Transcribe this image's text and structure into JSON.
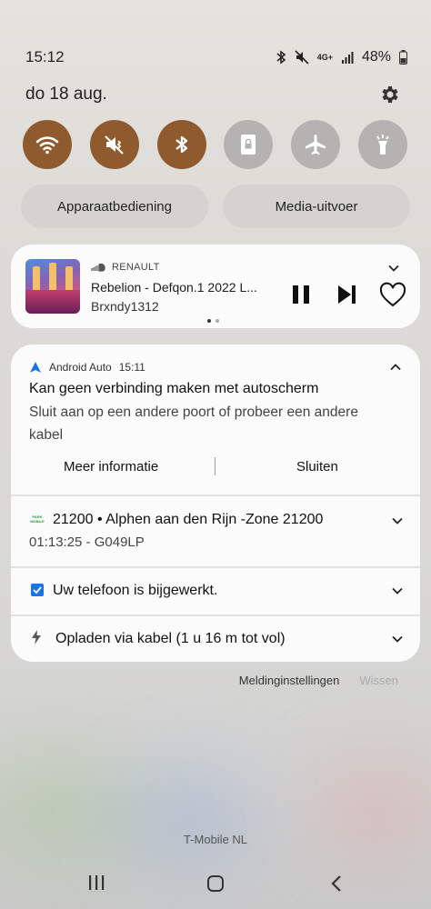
{
  "status_bar": {
    "time": "15:12",
    "battery": "48%",
    "network": "4G+"
  },
  "header": {
    "date": "do 18 aug."
  },
  "quick_toggles": [
    {
      "name": "wifi",
      "icon": "wifi-icon",
      "state": "on"
    },
    {
      "name": "mute",
      "icon": "mute-icon",
      "state": "on"
    },
    {
      "name": "bluetooth",
      "icon": "bluetooth-icon",
      "state": "on"
    },
    {
      "name": "auto-rotate",
      "icon": "portrait-lock-icon",
      "state": "off"
    },
    {
      "name": "airplane",
      "icon": "airplane-icon",
      "state": "off"
    },
    {
      "name": "flashlight",
      "icon": "flashlight-icon",
      "state": "off"
    }
  ],
  "pills": {
    "device_control": "Apparaatbediening",
    "media_output": "Media-uitvoer"
  },
  "media": {
    "source": "RENAULT",
    "title": "Rebelion  - Defqon.1 2022 L...",
    "artist": "Brxndy1312"
  },
  "notifications": {
    "android_auto": {
      "app": "Android Auto",
      "time": "15:11",
      "title": "Kan geen verbinding maken met autoscherm",
      "body": "Sluit aan op een andere poort of probeer een andere kabel",
      "action_more": "Meer informatie",
      "action_close": "Sluiten"
    },
    "parking": {
      "app_logo_text": "PARK MOBILE",
      "title": "21200 • Alphen aan den Rijn -Zone 21200",
      "subtitle": "01:13:25 - G049LP"
    },
    "update": {
      "title": "Uw telefoon is bijgewerkt."
    },
    "charging": {
      "title": "Opladen via kabel (1 u 16 m tot vol)"
    }
  },
  "footer": {
    "settings_link": "Meldinginstellingen",
    "clear_link": "Wissen",
    "carrier": "T-Mobile  NL"
  },
  "colors": {
    "toggle_on": "#8e5a2e",
    "toggle_off": "#b5b3b1",
    "accent_blue": "#1a73e8"
  }
}
